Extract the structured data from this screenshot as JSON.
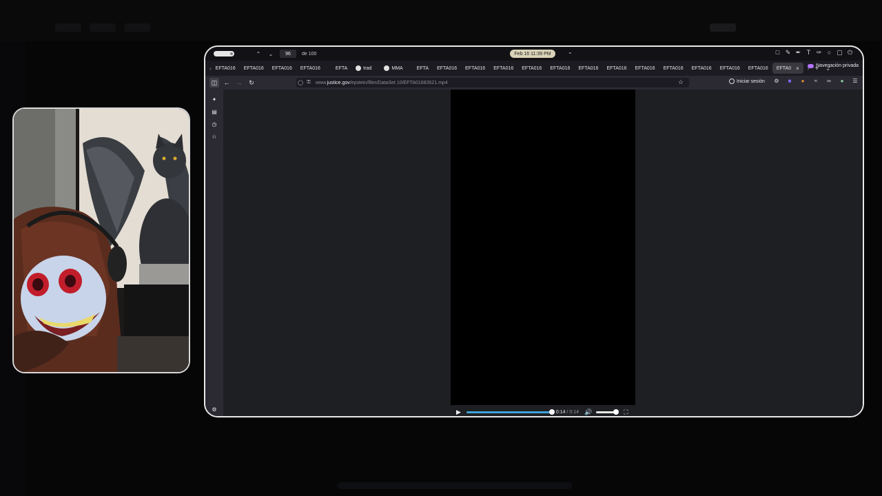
{
  "topbar": {
    "page_current": "96",
    "page_total": "de 100",
    "datetime": "Feb 16  11:39 PM"
  },
  "tabs": [
    {
      "label": "EFTA016",
      "favicon": false,
      "active": false
    },
    {
      "label": "EFTA016",
      "favicon": false,
      "active": false
    },
    {
      "label": "EFTA016",
      "favicon": false,
      "active": false
    },
    {
      "label": "EFTA016",
      "favicon": false,
      "active": false
    },
    {
      "label": "EFTA",
      "favicon": false,
      "active": false
    },
    {
      "label": "trad",
      "favicon": true,
      "active": false
    },
    {
      "label": "MMA",
      "favicon": true,
      "active": false
    },
    {
      "label": "EFTA",
      "favicon": false,
      "active": false
    },
    {
      "label": "EFTA016",
      "favicon": false,
      "active": false
    },
    {
      "label": "EFTA016",
      "favicon": false,
      "active": false
    },
    {
      "label": "EFTA016",
      "favicon": false,
      "active": false
    },
    {
      "label": "EFTA016",
      "favicon": false,
      "active": false
    },
    {
      "label": "EFTA016",
      "favicon": false,
      "active": false
    },
    {
      "label": "EFTA016",
      "favicon": false,
      "active": false
    },
    {
      "label": "EFTA016",
      "favicon": false,
      "active": false
    },
    {
      "label": "EFTA016",
      "favicon": false,
      "active": false
    },
    {
      "label": "EFTA016",
      "favicon": false,
      "active": false
    },
    {
      "label": "EFTA016",
      "favicon": false,
      "active": false
    },
    {
      "label": "EFTA016",
      "favicon": false,
      "active": false
    },
    {
      "label": "EFTA016",
      "favicon": false,
      "active": false
    },
    {
      "label": "EFTA0",
      "favicon": false,
      "active": true
    }
  ],
  "private_label": "Navegación privada",
  "url": {
    "host": "www.",
    "domain": "justice.gov",
    "path": "/epstein/files/DataSet 10/EFTA01683521.mp4"
  },
  "signin_label": "Iniciar sesión",
  "video": {
    "current_time": "0:14",
    "duration": "0:14",
    "progress": 1.0,
    "volume": 0.95
  },
  "colors": {
    "accent": "#3ea3d8",
    "private": "#b575ff"
  }
}
